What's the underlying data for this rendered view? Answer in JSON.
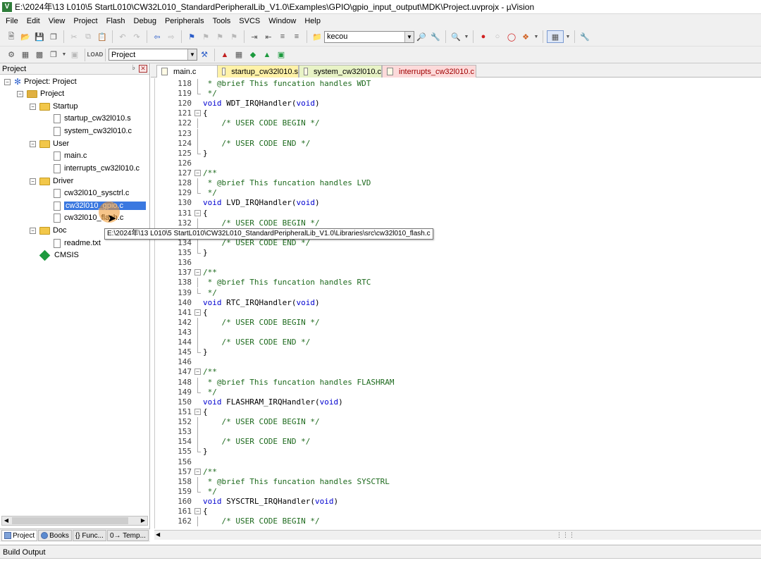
{
  "window": {
    "title": "E:\\2024年\\13 L010\\5 StartL010\\CW32L010_StandardPeripheralLib_V1.0\\Examples\\GPIO\\gpio_input_output\\MDK\\Project.uvprojx - µVision"
  },
  "menu": [
    "File",
    "Edit",
    "View",
    "Project",
    "Flash",
    "Debug",
    "Peripherals",
    "Tools",
    "SVCS",
    "Window",
    "Help"
  ],
  "toolbar": {
    "find_combo_value": "kecou",
    "target_combo_value": "Project"
  },
  "project_panel": {
    "title": "Project",
    "tree": {
      "root": "Project: Project",
      "target": "Project",
      "groups": [
        {
          "name": "Startup",
          "files": [
            "startup_cw32l010.s",
            "system_cw32l010.c"
          ]
        },
        {
          "name": "User",
          "files": [
            "main.c",
            "interrupts_cw32l010.c"
          ]
        },
        {
          "name": "Driver",
          "files": [
            "cw32l010_sysctrl.c",
            "cw32l010_gpio.c",
            "cw32l010_flash.c"
          ]
        },
        {
          "name": "Doc",
          "files": [
            "readme.txt"
          ]
        }
      ],
      "cmsis": "CMSIS"
    },
    "tooltip": "E:\\2024年\\13 L010\\5 StartL010\\CW32L010_StandardPeripheralLib_V1.0\\Libraries\\src\\cw32l010_flash.c",
    "bottom_tabs": [
      "Project",
      "Books",
      "{} Func...",
      "0→ Temp..."
    ]
  },
  "editor": {
    "tabs": [
      {
        "name": "main.c",
        "color": "#ffffff"
      },
      {
        "name": "startup_cw32l010.s",
        "color": "#fff2a8"
      },
      {
        "name": "system_cw32l010.c",
        "color": "#e8f3c6"
      },
      {
        "name": "interrupts_cw32l010.c",
        "color": "#fcdada",
        "active": true
      }
    ],
    "lines": [
      {
        "n": "118",
        "t": " * @brief This funcation handles WDT",
        "c": "cm",
        "f": "line"
      },
      {
        "n": "119",
        "t": " */",
        "c": "cm",
        "f": "end"
      },
      {
        "n": "120",
        "t": "void WDT_IRQHandler(void)",
        "c": "fn",
        "f": ""
      },
      {
        "n": "121",
        "t": "{",
        "c": "",
        "f": "box"
      },
      {
        "n": "122",
        "t": "    /* USER CODE BEGIN */",
        "c": "cm",
        "f": "line"
      },
      {
        "n": "123",
        "t": "",
        "c": "",
        "f": "line"
      },
      {
        "n": "124",
        "t": "    /* USER CODE END */",
        "c": "cm",
        "f": "line"
      },
      {
        "n": "125",
        "t": "}",
        "c": "",
        "f": "end"
      },
      {
        "n": "126",
        "t": "",
        "c": "",
        "f": ""
      },
      {
        "n": "127",
        "t": "/**",
        "c": "cm",
        "f": "box"
      },
      {
        "n": "128",
        "t": " * @brief This funcation handles LVD",
        "c": "cm",
        "f": "line"
      },
      {
        "n": "129",
        "t": " */",
        "c": "cm",
        "f": "end"
      },
      {
        "n": "130",
        "t": "void LVD_IRQHandler(void)",
        "c": "fn",
        "f": ""
      },
      {
        "n": "131",
        "t": "{",
        "c": "",
        "f": "box"
      },
      {
        "n": "132",
        "t": "    /* USER CODE BEGIN */",
        "c": "cm",
        "f": "line"
      },
      {
        "n": "133",
        "t": "",
        "c": "",
        "f": "line"
      },
      {
        "n": "134",
        "t": "    /* USER CODE END */",
        "c": "cm",
        "f": "line"
      },
      {
        "n": "135",
        "t": "}",
        "c": "",
        "f": "end"
      },
      {
        "n": "136",
        "t": "",
        "c": "",
        "f": ""
      },
      {
        "n": "137",
        "t": "/**",
        "c": "cm",
        "f": "box"
      },
      {
        "n": "138",
        "t": " * @brief This funcation handles RTC",
        "c": "cm",
        "f": "line"
      },
      {
        "n": "139",
        "t": " */",
        "c": "cm",
        "f": "end"
      },
      {
        "n": "140",
        "t": "void RTC_IRQHandler(void)",
        "c": "fn",
        "f": ""
      },
      {
        "n": "141",
        "t": "{",
        "c": "",
        "f": "box"
      },
      {
        "n": "142",
        "t": "    /* USER CODE BEGIN */",
        "c": "cm",
        "f": "line"
      },
      {
        "n": "143",
        "t": "",
        "c": "",
        "f": "line"
      },
      {
        "n": "144",
        "t": "    /* USER CODE END */",
        "c": "cm",
        "f": "line"
      },
      {
        "n": "145",
        "t": "}",
        "c": "",
        "f": "end"
      },
      {
        "n": "146",
        "t": "",
        "c": "",
        "f": ""
      },
      {
        "n": "147",
        "t": "/**",
        "c": "cm",
        "f": "box"
      },
      {
        "n": "148",
        "t": " * @brief This funcation handles FLASHRAM",
        "c": "cm",
        "f": "line"
      },
      {
        "n": "149",
        "t": " */",
        "c": "cm",
        "f": "end"
      },
      {
        "n": "150",
        "t": "void FLASHRAM_IRQHandler(void)",
        "c": "fn",
        "f": ""
      },
      {
        "n": "151",
        "t": "{",
        "c": "",
        "f": "box"
      },
      {
        "n": "152",
        "t": "    /* USER CODE BEGIN */",
        "c": "cm",
        "f": "line"
      },
      {
        "n": "153",
        "t": "",
        "c": "",
        "f": "line"
      },
      {
        "n": "154",
        "t": "    /* USER CODE END */",
        "c": "cm",
        "f": "line"
      },
      {
        "n": "155",
        "t": "}",
        "c": "",
        "f": "end"
      },
      {
        "n": "156",
        "t": "",
        "c": "",
        "f": ""
      },
      {
        "n": "157",
        "t": "/**",
        "c": "cm",
        "f": "box"
      },
      {
        "n": "158",
        "t": " * @brief This funcation handles SYSCTRL",
        "c": "cm",
        "f": "line"
      },
      {
        "n": "159",
        "t": " */",
        "c": "cm",
        "f": "end"
      },
      {
        "n": "160",
        "t": "void SYSCTRL_IRQHandler(void)",
        "c": "fn",
        "f": ""
      },
      {
        "n": "161",
        "t": "{",
        "c": "",
        "f": "box"
      },
      {
        "n": "162",
        "t": "    /* USER CODE BEGIN */",
        "c": "cm",
        "f": "line"
      }
    ]
  },
  "build_output": {
    "title": "Build Output"
  },
  "colors": {
    "comment": "#1e6a1e",
    "keyword": "#0000d0",
    "selection": "#3a78e0"
  }
}
